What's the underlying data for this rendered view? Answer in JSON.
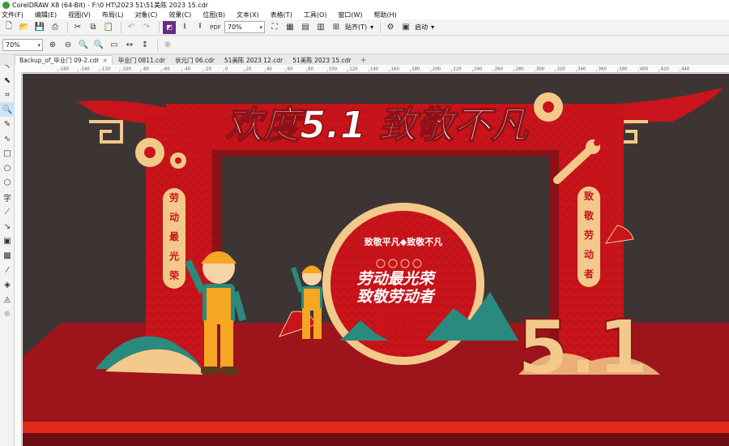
{
  "window": {
    "title": "CorelDRAW X8 (64-Bit) - F:\\0 HT\\2023 51\\51美陈 2023 15.cdr"
  },
  "menu": [
    "文件(F)",
    "编辑(E)",
    "视图(V)",
    "布局(L)",
    "对象(C)",
    "效果(C)",
    "位图(B)",
    "文本(X)",
    "表格(T)",
    "工具(O)",
    "窗口(W)",
    "帮助(H)"
  ],
  "toolbar": {
    "zoom_value": "70%",
    "snap_label": "贴齐(T)",
    "launch_label": "启动"
  },
  "property_bar": {
    "zoom_value": "70%"
  },
  "tabs": [
    "Backup_of_毕业门 09-2.cdr",
    "毕业门 0811.cdr",
    "状元门 06.cdr",
    "51美陈 2023 12.cdr",
    "51美陈 2023 15.cdr"
  ],
  "ruler_labels": [
    "-160",
    "-140",
    "-120",
    "-100",
    "-80",
    "-60",
    "-40",
    "-20",
    "0",
    "20",
    "40",
    "60",
    "80",
    "100",
    "120",
    "140",
    "160",
    "180",
    "200",
    "220",
    "240",
    "260",
    "280",
    "300",
    "320",
    "340",
    "360",
    "380",
    "400",
    "420",
    "440"
  ],
  "artwork": {
    "headline": "欢度5.1 致敬不凡",
    "left_pillar_text": [
      "劳",
      "动",
      "最",
      "光",
      "荣"
    ],
    "right_pillar_text": [
      "致",
      "敬",
      "劳",
      "动",
      "者"
    ],
    "center_arc_text": "致敬平凡◆致敬不凡",
    "center_line_1": "劳动最光荣",
    "center_line_2": "致敬劳动者",
    "big_number": "5.1"
  },
  "colors": {
    "arch_red": "#c8141a",
    "dark_red": "#8a1218",
    "gold": "#f3c98b",
    "stage_floor": "#a3161c",
    "stage_stripe": "#e02a1c",
    "canvas_bg": "#3c3534"
  }
}
